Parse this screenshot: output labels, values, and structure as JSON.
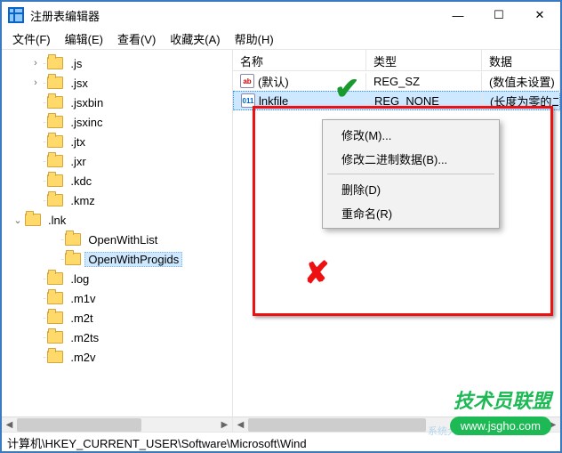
{
  "title": "注册表编辑器",
  "window_controls": {
    "min": "—",
    "max": "☐",
    "close": "✕"
  },
  "menus": [
    "文件(F)",
    "编辑(E)",
    "查看(V)",
    "收藏夹(A)",
    "帮助(H)"
  ],
  "tree": [
    {
      "indent": 1,
      "twisty": ">",
      "label": ".js"
    },
    {
      "indent": 1,
      "twisty": ">",
      "label": ".jsx"
    },
    {
      "indent": 1,
      "twisty": "",
      "label": ".jsxbin"
    },
    {
      "indent": 1,
      "twisty": "",
      "label": ".jsxinc"
    },
    {
      "indent": 1,
      "twisty": "",
      "label": ".jtx"
    },
    {
      "indent": 1,
      "twisty": "",
      "label": ".jxr"
    },
    {
      "indent": 1,
      "twisty": "",
      "label": ".kdc"
    },
    {
      "indent": 1,
      "twisty": "",
      "label": ".kmz"
    },
    {
      "indent": 0,
      "twisty": "v",
      "label": ".lnk"
    },
    {
      "indent": 2,
      "twisty": "",
      "label": "OpenWithList"
    },
    {
      "indent": 2,
      "twisty": "",
      "label": "OpenWithProgids",
      "selected": true
    },
    {
      "indent": 1,
      "twisty": "",
      "label": ".log"
    },
    {
      "indent": 1,
      "twisty": "",
      "label": ".m1v"
    },
    {
      "indent": 1,
      "twisty": "",
      "label": ".m2t"
    },
    {
      "indent": 1,
      "twisty": "",
      "label": ".m2ts"
    },
    {
      "indent": 1,
      "twisty": "",
      "label": ".m2v"
    }
  ],
  "columns": {
    "name": "名称",
    "type": "类型",
    "data": "数据"
  },
  "values": [
    {
      "icon": "str",
      "name": "(默认)",
      "type": "REG_SZ",
      "data": "(数值未设置)"
    },
    {
      "icon": "bin",
      "name": "lnkfile",
      "type": "REG_NONE",
      "data": "(长度为零的二进制值)",
      "selected": true
    }
  ],
  "context_menu": [
    "修改(M)...",
    "修改二进制数据(B)...",
    "—",
    "删除(D)",
    "重命名(R)"
  ],
  "statusbar": "计算机\\HKEY_CURRENT_USER\\Software\\Microsoft\\Wind",
  "watermark": {
    "text": "技术员联盟",
    "url": "www.jsgho.com",
    "sub": "系统大全"
  }
}
